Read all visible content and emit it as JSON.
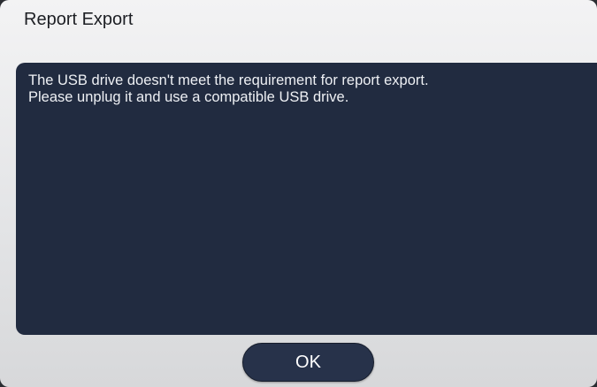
{
  "dialog": {
    "title": "Report Export",
    "message_lines": [
      "The USB drive doesn't meet the requirement for report export.",
      "Please unplug it and use a compatible USB drive."
    ],
    "ok_label": "OK"
  },
  "colors": {
    "dialog_background": "#e4e5e7",
    "message_panel": "#212b40",
    "message_text": "#eef0f4",
    "button_background": "#27324a",
    "button_text": "#ffffff"
  }
}
